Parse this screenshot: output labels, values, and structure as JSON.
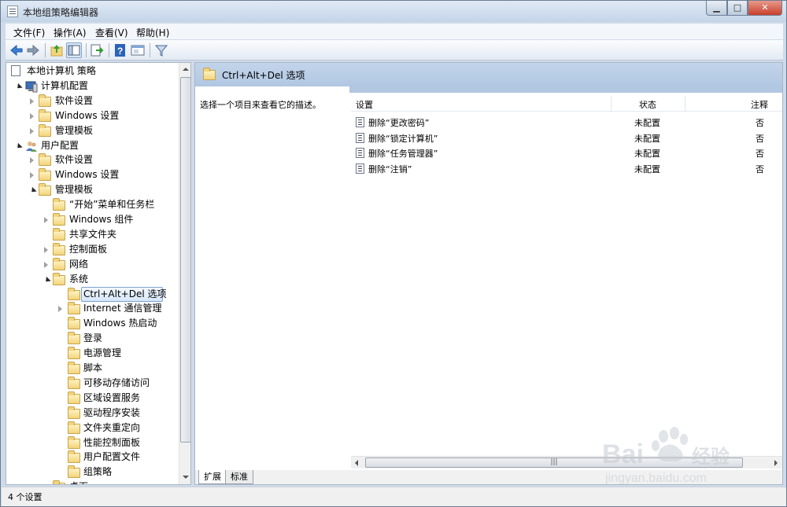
{
  "window": {
    "title": "本地组策略编辑器"
  },
  "menu": [
    {
      "label": "文件(F)"
    },
    {
      "label": "操作(A)"
    },
    {
      "label": "查看(V)"
    },
    {
      "label": "帮助(H)"
    }
  ],
  "toolbar": [
    "back-icon",
    "forward-icon",
    "up-folder-icon",
    "show-hide-tree-icon",
    "export-list-icon",
    "help-icon",
    "properties-icon",
    "filter-icon"
  ],
  "tree": [
    {
      "label": "本地计算机 策略",
      "level": 0,
      "icon": "policy-doc-icon"
    },
    {
      "label": "计算机配置",
      "level": 1,
      "icon": "computer-icon",
      "state": "open"
    },
    {
      "label": "软件设置",
      "level": 2,
      "state": "closed"
    },
    {
      "label": "Windows 设置",
      "level": 2,
      "state": "closed"
    },
    {
      "label": "管理模板",
      "level": 2,
      "state": "closed"
    },
    {
      "label": "用户配置",
      "level": 1,
      "icon": "user-icon",
      "state": "open"
    },
    {
      "label": "软件设置",
      "level": 2,
      "state": "closed"
    },
    {
      "label": "Windows 设置",
      "level": 2,
      "state": "closed"
    },
    {
      "label": "管理模板",
      "level": 2,
      "state": "open"
    },
    {
      "label": "“开始”菜单和任务栏",
      "level": 3
    },
    {
      "label": "Windows 组件",
      "level": 3,
      "state": "closed"
    },
    {
      "label": "共享文件夹",
      "level": 3
    },
    {
      "label": "控制面板",
      "level": 3,
      "state": "closed"
    },
    {
      "label": "网络",
      "level": 3,
      "state": "closed"
    },
    {
      "label": "系统",
      "level": 3,
      "state": "open"
    },
    {
      "label": "Ctrl+Alt+Del 选项",
      "level": 4,
      "selected": true
    },
    {
      "label": "Internet 通信管理",
      "level": 4,
      "state": "closed"
    },
    {
      "label": "Windows 热启动",
      "level": 4
    },
    {
      "label": "登录",
      "level": 4
    },
    {
      "label": "电源管理",
      "level": 4
    },
    {
      "label": "脚本",
      "level": 4
    },
    {
      "label": "可移动存储访问",
      "level": 4
    },
    {
      "label": "区域设置服务",
      "level": 4
    },
    {
      "label": "驱动程序安装",
      "level": 4
    },
    {
      "label": "文件夹重定向",
      "level": 4
    },
    {
      "label": "性能控制面板",
      "level": 4
    },
    {
      "label": "用户配置文件",
      "level": 4
    },
    {
      "label": "组策略",
      "level": 4
    },
    {
      "label": "桌面",
      "level": 3,
      "state": "closed"
    }
  ],
  "right": {
    "header": "Ctrl+Alt+Del 选项",
    "description": "选择一个项目来查看它的描述。",
    "columns": [
      "设置",
      "状态",
      "注释"
    ],
    "rows": [
      {
        "setting": "删除“更改密码”",
        "state": "未配置",
        "note": "否"
      },
      {
        "setting": "删除“锁定计算机”",
        "state": "未配置",
        "note": "否"
      },
      {
        "setting": "删除“任务管理器”",
        "state": "未配置",
        "note": "否"
      },
      {
        "setting": "删除“注销”",
        "state": "未配置",
        "note": "否"
      }
    ],
    "tabs": [
      "扩展",
      "标准"
    ]
  },
  "status": "4 个设置",
  "watermark": {
    "brand": "Baidu经验",
    "url": "jingyan.baidu.com"
  }
}
